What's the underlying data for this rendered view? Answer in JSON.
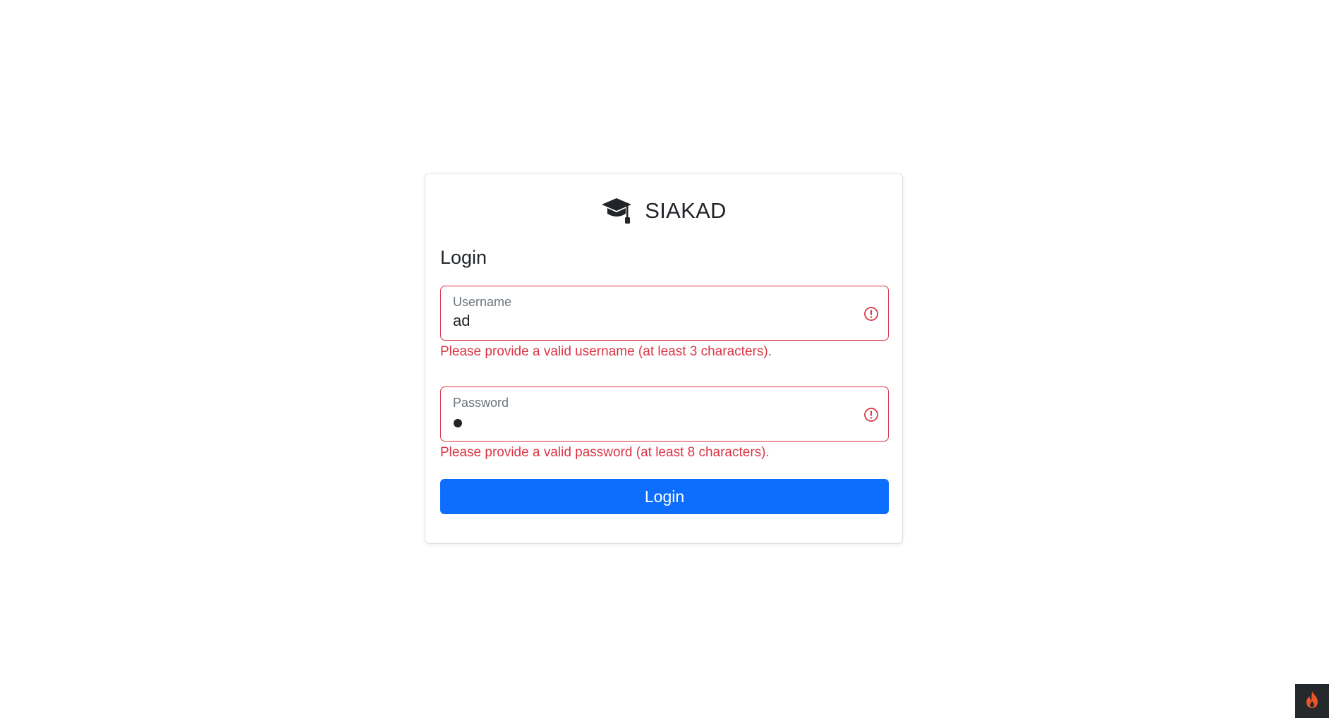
{
  "brand": {
    "title": "SIAKAD",
    "icon": "graduation-cap-icon"
  },
  "form": {
    "heading": "Login",
    "username": {
      "label": "Username",
      "value": "ad",
      "error": "Please provide a valid username (at least 3 characters)."
    },
    "password": {
      "label": "Password",
      "masked_char_count": 1,
      "error": "Please provide a valid password (at least 8 characters)."
    },
    "submit_label": "Login"
  },
  "colors": {
    "accent": "#0d6efd",
    "danger": "#dc3545",
    "text": "#212529",
    "muted": "#6c757d"
  },
  "corner_badge": {
    "icon": "flame-icon",
    "color": "#e8562a"
  }
}
